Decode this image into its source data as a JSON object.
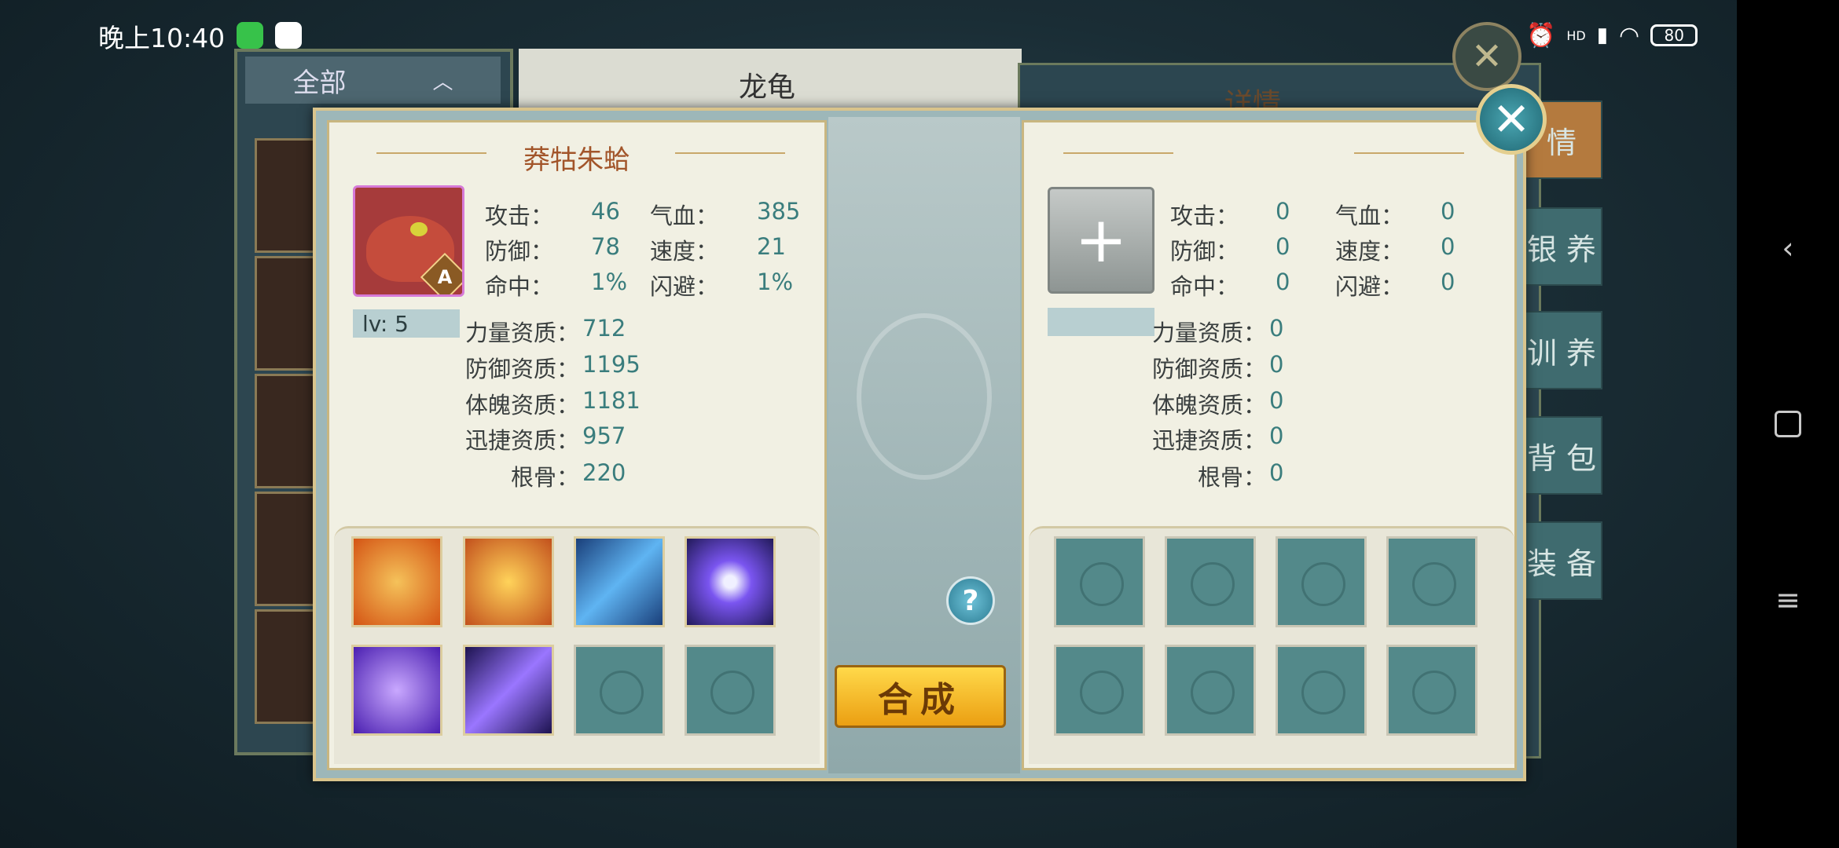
{
  "status_bar": {
    "time": "晚上10:40",
    "battery": "80",
    "hd_label": "HD"
  },
  "background": {
    "filter_label": "全部",
    "mid_title": "龙龟",
    "right_title": "详情",
    "side_tabs": [
      "情",
      "银 养",
      "训 养",
      "背 包",
      "装 备"
    ]
  },
  "dialog": {
    "left": {
      "pet_name": "莽牯朱蛤",
      "grade": "A",
      "level": "lv: 5",
      "stats": [
        {
          "label": "攻击：",
          "value": "46"
        },
        {
          "label": "气血：",
          "value": "385"
        },
        {
          "label": "防御：",
          "value": "78"
        },
        {
          "label": "速度：",
          "value": "21"
        },
        {
          "label": "命中：",
          "value": "1%"
        },
        {
          "label": "闪避：",
          "value": "1%"
        }
      ],
      "aptitudes": [
        {
          "label": "力量资质：",
          "value": "712"
        },
        {
          "label": "防御资质：",
          "value": "1195"
        },
        {
          "label": "体魄资质：",
          "value": "1181"
        },
        {
          "label": "迅捷资质：",
          "value": "957"
        },
        {
          "label": "根骨：",
          "value": "220"
        }
      ],
      "skills": [
        {
          "icon": "fire-shield-skill-icon",
          "filled": true,
          "color": "#e96a1a"
        },
        {
          "icon": "fireball-skill-icon",
          "filled": true,
          "color": "#f2a43a"
        },
        {
          "icon": "lightning-arrow-skill-icon",
          "filled": true,
          "color": "#2f7fd8"
        },
        {
          "icon": "energy-orb-skill-icon",
          "filled": true,
          "color": "#6a38d8"
        },
        {
          "icon": "purple-vortex-skill-icon",
          "filled": true,
          "color": "#6d3fe0"
        },
        {
          "icon": "purple-slash-skill-icon",
          "filled": true,
          "color": "#5a2cb8"
        },
        {
          "icon": "empty-slot-icon",
          "filled": false
        },
        {
          "icon": "empty-slot-icon",
          "filled": false
        }
      ]
    },
    "right": {
      "stats": [
        {
          "label": "攻击：",
          "value": "0"
        },
        {
          "label": "气血：",
          "value": "0"
        },
        {
          "label": "防御：",
          "value": "0"
        },
        {
          "label": "速度：",
          "value": "0"
        },
        {
          "label": "命中：",
          "value": "0"
        },
        {
          "label": "闪避：",
          "value": "0"
        }
      ],
      "aptitudes": [
        {
          "label": "力量资质：",
          "value": "0"
        },
        {
          "label": "防御资质：",
          "value": "0"
        },
        {
          "label": "体魄资质：",
          "value": "0"
        },
        {
          "label": "迅捷资质：",
          "value": "0"
        },
        {
          "label": "根骨：",
          "value": "0"
        }
      ]
    },
    "help_label": "?",
    "compose_label": "合成"
  }
}
